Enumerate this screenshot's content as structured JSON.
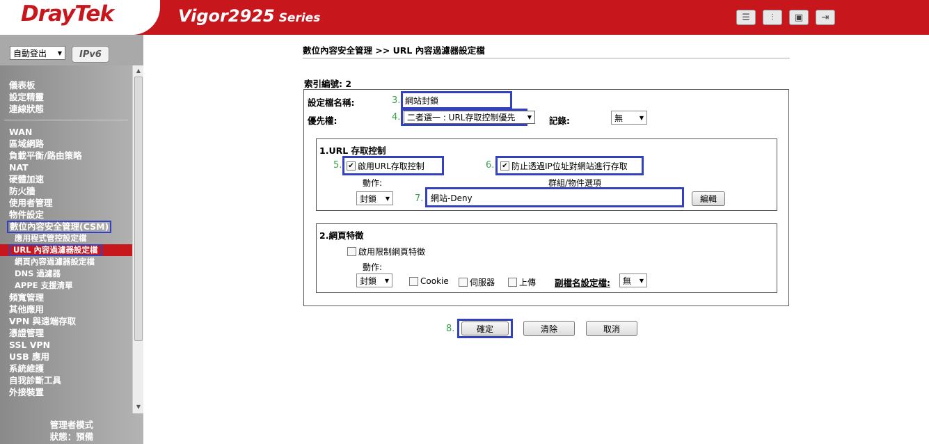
{
  "header": {
    "brand": "DrayTek",
    "model": "Vigor2925",
    "series": "Series",
    "icons": [
      "layout-icon",
      "settings-sliders-icon",
      "save-icon",
      "logout-icon"
    ]
  },
  "sidebar": {
    "logout_select": "自動登出",
    "ipv6_label": "IPv6",
    "group1": [
      "儀表板",
      "設定精靈",
      "連線狀態"
    ],
    "group2": [
      "WAN",
      "區域網路",
      "負載平衡/路由策略",
      "NAT",
      "硬體加速",
      "防火牆",
      "使用者管理",
      "物件設定"
    ],
    "csm": "數位內容安全管理(CSM)",
    "csm_subs": [
      "應用程式管控設定檔",
      "URL 內容過濾器設定檔",
      "網頁內容過濾器設定檔",
      "DNS 過濾器",
      "APPE 支援清單"
    ],
    "group3": [
      "頻寬管理",
      "其他應用",
      "VPN 與遠端存取",
      "憑證管理",
      "SSL VPN",
      "USB 應用",
      "系統維護",
      "自我診斷工具",
      "外接裝置"
    ],
    "admin_mode": "管理者模式",
    "status": "狀態：預備"
  },
  "main": {
    "breadcrumb": "數位內容安全管理 >> URL 內容過濾器設定檔",
    "index_label": "索引編號: 2",
    "profile_name_label": "設定檔名稱:",
    "profile_name_value": "網站封鎖",
    "priority_label": "優先權:",
    "priority_value": "二者選一 : URL存取控制優先",
    "log_label": "記錄:",
    "log_value": "無",
    "step3": "3.",
    "step4": "4.",
    "step5": "5.",
    "step6": "6.",
    "step7": "7.",
    "step8": "8.",
    "section1": {
      "title": "1.URL 存取控制",
      "enable_label": "啟用URL存取控制",
      "enable_checked": true,
      "prevent_ip_label": "防止透過IP位址對網站進行存取",
      "prevent_ip_checked": true,
      "action_label": "動作:",
      "action_value": "封鎖",
      "group_label": "群組/物件選項",
      "group_value": "網站-Deny",
      "edit_button": "編輯"
    },
    "section2": {
      "title": "2.網頁特徵",
      "enable_label": "啟用限制網頁特徵",
      "enable_checked": false,
      "action_label": "動作:",
      "action_value": "封鎖",
      "cookie_label": "Cookie",
      "proxy_label": "伺服器",
      "upload_label": "上傳",
      "ext_label": "副檔名設定檔:",
      "ext_value": "無"
    },
    "buttons": {
      "ok": "確定",
      "clear": "清除",
      "cancel": "取消"
    }
  }
}
